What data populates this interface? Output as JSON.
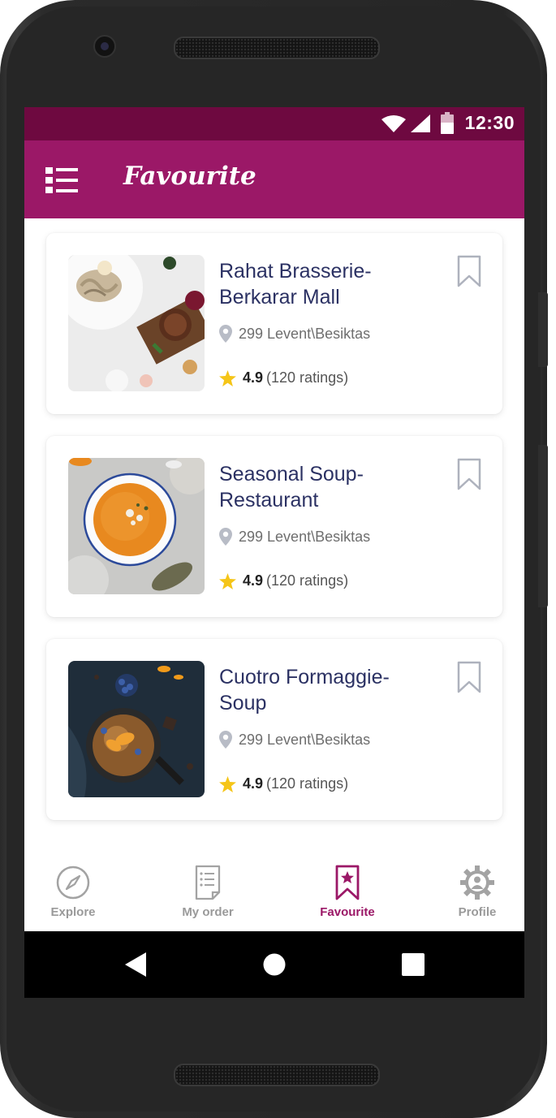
{
  "status_bar": {
    "time": "12:30",
    "icons": [
      "wifi-icon",
      "signal-icon",
      "battery-icon"
    ]
  },
  "app_bar": {
    "title": "Favourite",
    "menu_icon": "menu-list-icon"
  },
  "colors": {
    "primary": "#9b1867",
    "status_bar": "#6e0940",
    "title_text": "#2b3163",
    "star": "#f5c518",
    "inactive": "#9a9a9a"
  },
  "restaurants": [
    {
      "name_line1": "Rahat Brasserie-",
      "name_line2": "Berkarar Mall",
      "address": "299 Levent\\Besiktas",
      "rating": "4.9",
      "ratings_count": "(120 ratings)"
    },
    {
      "name_line1": "Seasonal Soup-",
      "name_line2": "Restaurant",
      "address": "299 Levent\\Besiktas",
      "rating": "4.9",
      "ratings_count": "(120 ratings)"
    },
    {
      "name_line1": "Cuotro Formaggie-",
      "name_line2": "Soup",
      "address": "299 Levent\\Besiktas",
      "rating": "4.9",
      "ratings_count": "(120 ratings)"
    }
  ],
  "bottom_nav": [
    {
      "label": "Explore",
      "icon": "compass-icon",
      "active": false
    },
    {
      "label": "My order",
      "icon": "receipt-icon",
      "active": false
    },
    {
      "label": "Favourite",
      "icon": "bookmark-star-icon",
      "active": true
    },
    {
      "label": "Profile",
      "icon": "gear-profile-icon",
      "active": false
    }
  ],
  "system_nav": [
    "back-icon",
    "home-icon",
    "recents-icon"
  ]
}
